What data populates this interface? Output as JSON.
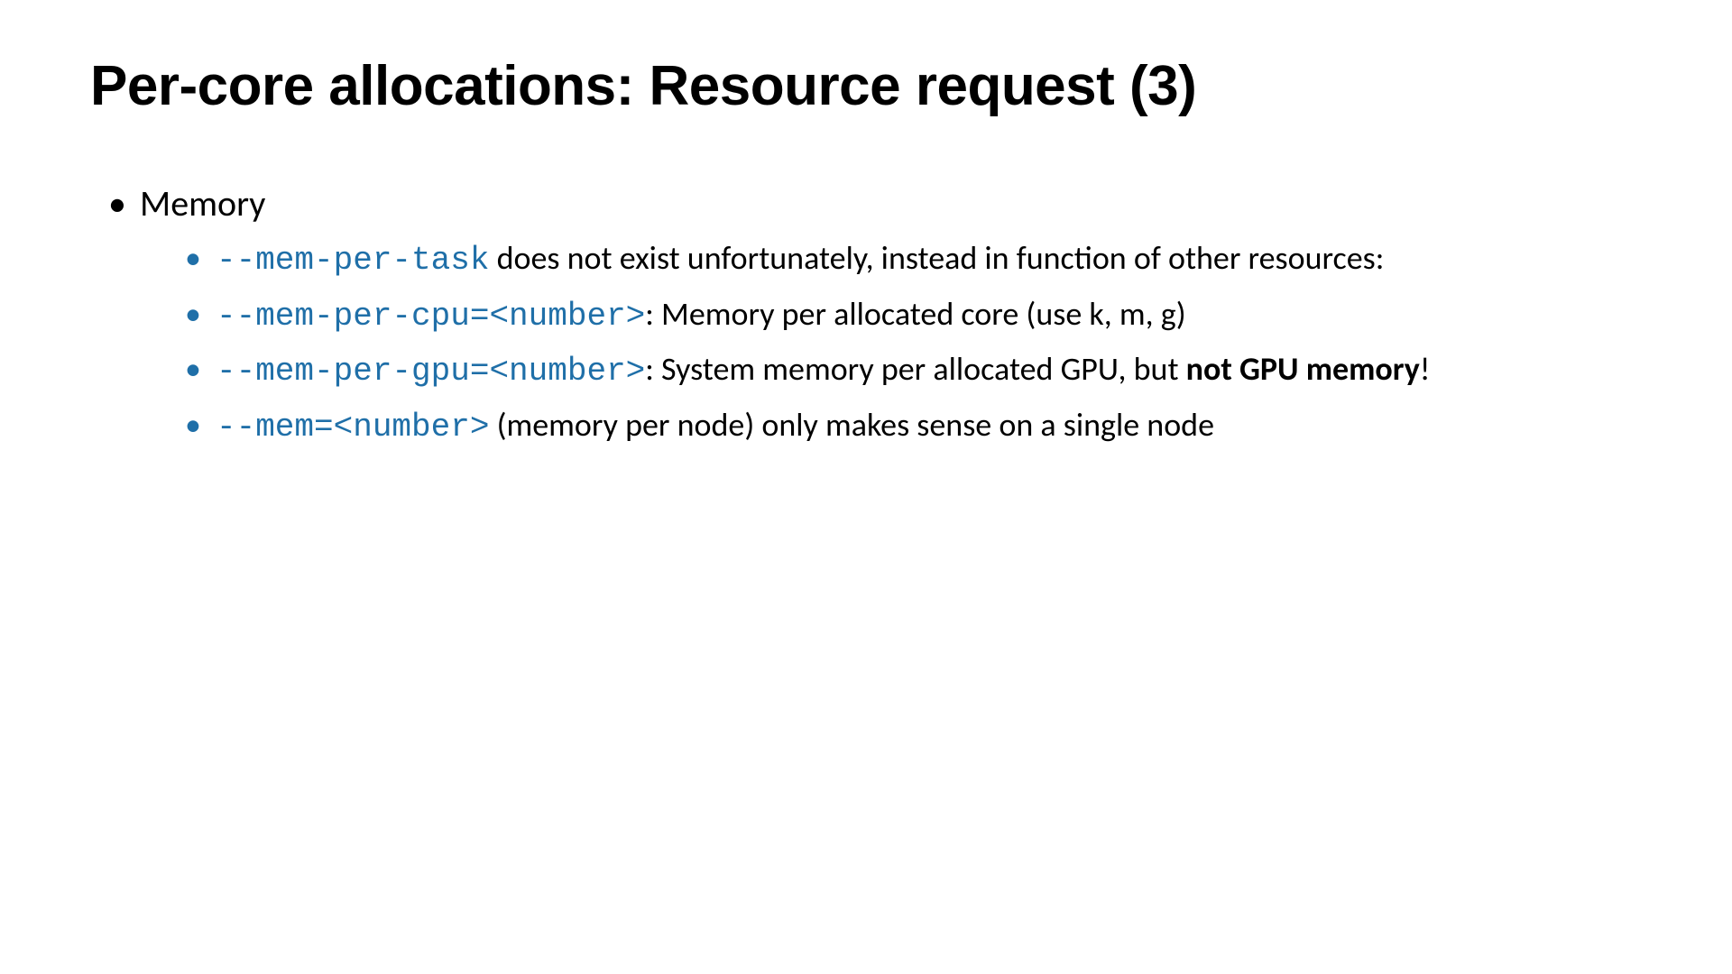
{
  "title": "Per-core allocations: Resource request (3)",
  "section": "Memory",
  "bullets": {
    "b1_code": "--mem-per-task",
    "b1_text": " does not exist unfortunately, instead in function of other resources:",
    "b2_code": "--mem-per-cpu=<number>",
    "b2_text": ": Memory per allocated core (use k, m, g)",
    "b3_code": "--mem-per-gpu=<number>",
    "b3_text_a": ": System memory per allocated GPU, but ",
    "b3_bold": "not GPU memory",
    "b3_text_b": "!",
    "b4_code": "--mem=<number>",
    "b4_text": " (memory per node) only makes sense on a single node"
  }
}
